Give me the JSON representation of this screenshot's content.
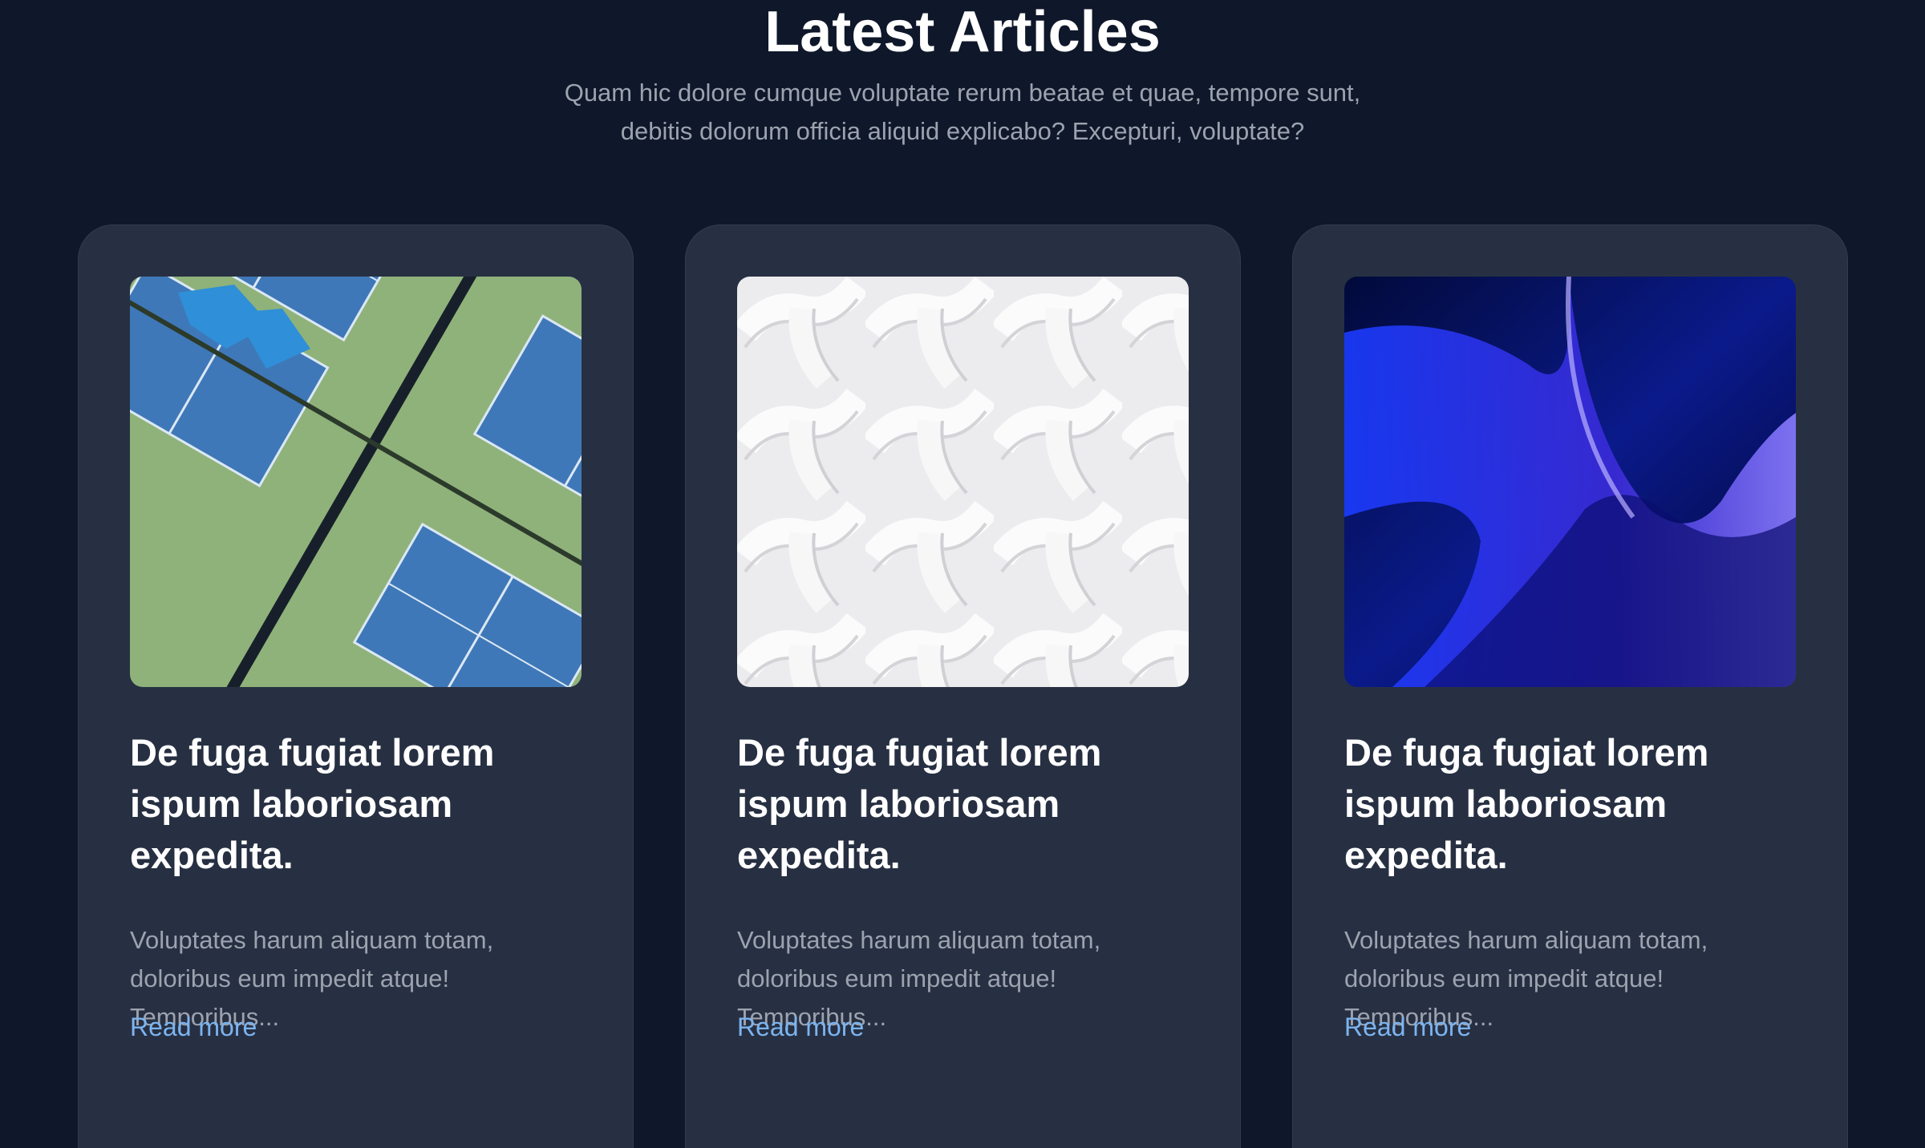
{
  "section": {
    "heading": "Latest Articles",
    "subtitle_line1": "Quam hic dolore cumque voluptate rerum beatae et quae, tempore sunt,",
    "subtitle_line2": "debitis dolorum officia aliquid explicabo? Excepturi, voluptate?"
  },
  "articles": [
    {
      "image": "aerial-tennis-courts-image",
      "title": "De fuga fugiat lorem ispum laboriosam expedita.",
      "excerpt": "Voluptates harum aliquam totam, doloribus eum impedit atque! Temporibus...",
      "link_label": "Read more"
    },
    {
      "image": "white-woven-pattern-image",
      "title": "De fuga fugiat lorem ispum laboriosam expedita.",
      "excerpt": "Voluptates harum aliquam totam, doloribus eum impedit atque! Temporibus...",
      "link_label": "Read more"
    },
    {
      "image": "blue-abstract-gradient-image",
      "title": "De fuga fugiat lorem ispum laboriosam expedita.",
      "excerpt": "Voluptates harum aliquam totam, doloribus eum impedit atque! Temporibus...",
      "link_label": "Read more"
    }
  ],
  "colors": {
    "background": "#0f172a",
    "card": "#273042",
    "heading": "#ffffff",
    "muted_text": "#9ca3af",
    "link": "#7cb4f0"
  }
}
